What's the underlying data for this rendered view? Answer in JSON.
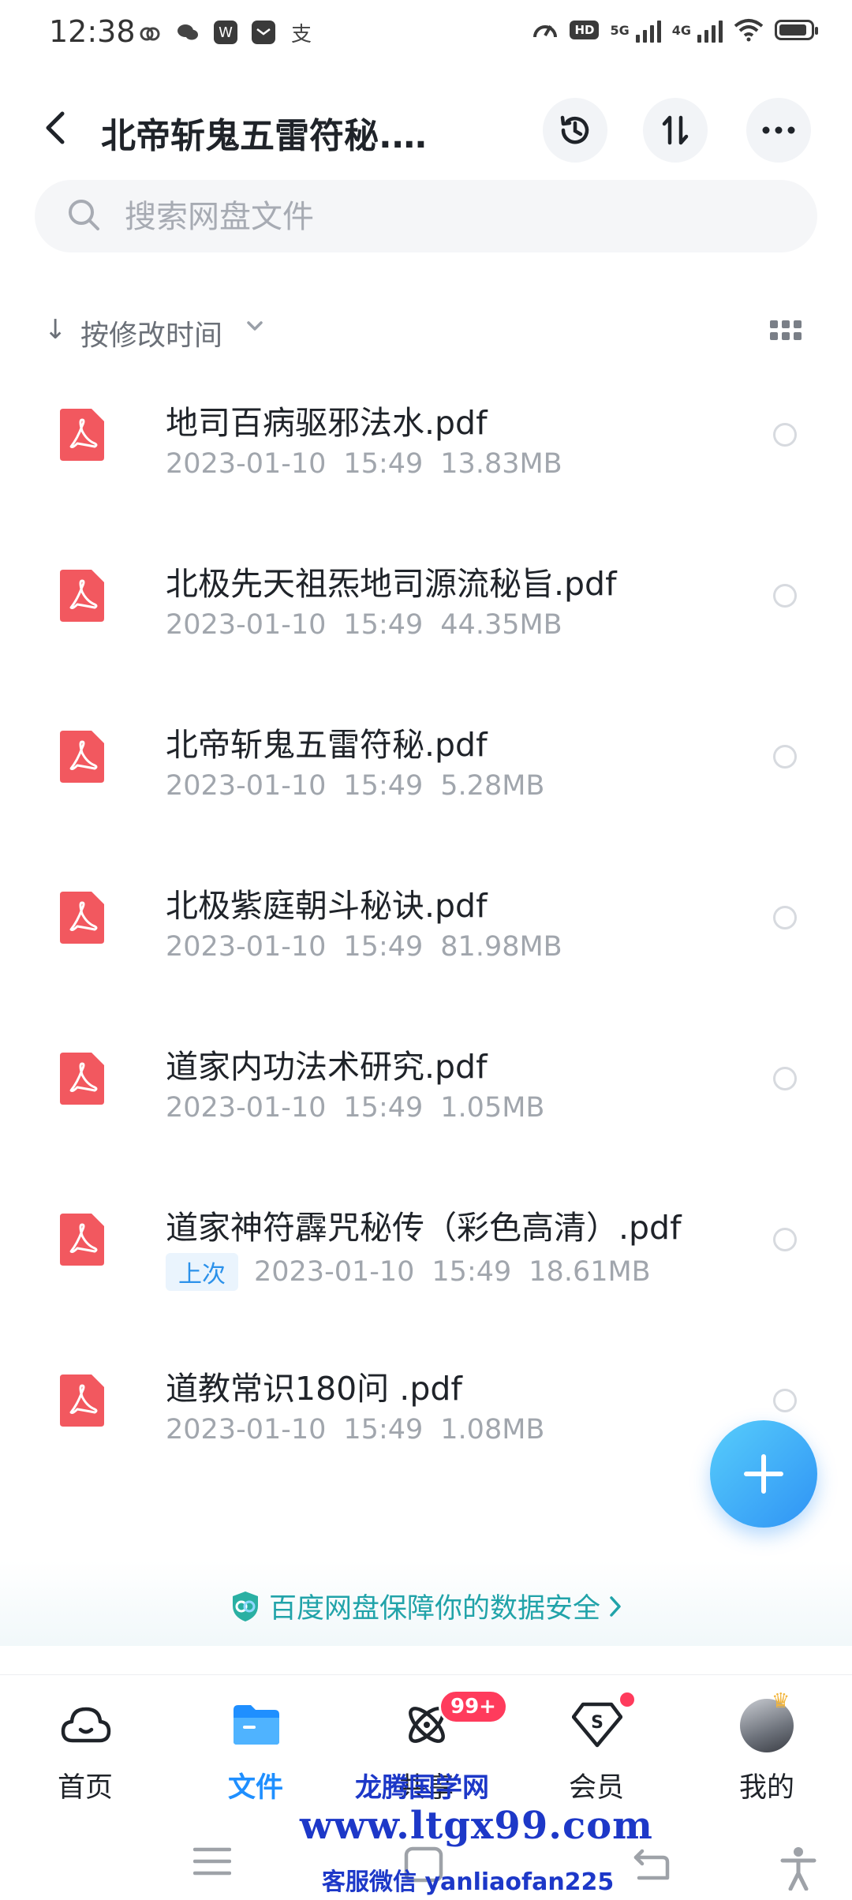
{
  "status_bar": {
    "time": "12:38",
    "app_icons": [
      "baidu-app-icon",
      "wechat-icon",
      "w-app-icon",
      "message-app-icon",
      "alipay-icon"
    ],
    "network_1": "5G",
    "network_2": "4G",
    "hd_label": "HD"
  },
  "header": {
    "title": "北帝斩鬼五雷符秘.…",
    "actions": [
      "history-icon",
      "sort-icon",
      "more-icon"
    ]
  },
  "search": {
    "placeholder": "搜索网盘文件"
  },
  "sort": {
    "label": "按修改时间"
  },
  "files": [
    {
      "name": "地司百病驱邪法水.pdf",
      "date": "2023-01-10",
      "time": "15:49",
      "size": "13.83MB",
      "tag": ""
    },
    {
      "name": "北极先天祖炁地司源流秘旨.pdf",
      "date": "2023-01-10",
      "time": "15:49",
      "size": "44.35MB",
      "tag": ""
    },
    {
      "name": "北帝斩鬼五雷符秘.pdf",
      "date": "2023-01-10",
      "time": "15:49",
      "size": "5.28MB",
      "tag": ""
    },
    {
      "name": "北极紫庭朝斗秘诀.pdf",
      "date": "2023-01-10",
      "time": "15:49",
      "size": "81.98MB",
      "tag": ""
    },
    {
      "name": "道家内功法术研究.pdf",
      "date": "2023-01-10",
      "time": "15:49",
      "size": "1.05MB",
      "tag": ""
    },
    {
      "name": "道家神符霹咒秘传（彩色高清）.pdf",
      "date": "2023-01-10",
      "time": "15:49",
      "size": "18.61MB",
      "tag": "上次"
    },
    {
      "name": "道教常识180问 .pdf",
      "date": "2023-01-10",
      "time": "15:49",
      "size": "1.08MB",
      "tag": ""
    }
  ],
  "banner": {
    "text": "百度网盘保障你的数据安全"
  },
  "bottom_nav": {
    "items": [
      {
        "label": "首页",
        "icon": "cloud-icon",
        "active": false
      },
      {
        "label": "文件",
        "icon": "folder-icon",
        "active": true
      },
      {
        "label": "共享",
        "icon": "atom-icon",
        "active": false,
        "badge": "99+"
      },
      {
        "label": "会员",
        "icon": "diamond-icon",
        "active": false
      },
      {
        "label": "我的",
        "icon": "avatar",
        "active": false
      }
    ]
  },
  "watermark": {
    "title": "龙腾国学网",
    "url": "www.ltgx99.com",
    "contact": "客服微信 yanliaofan225"
  },
  "colors": {
    "accent": "#1f8fff",
    "pdf_red": "#f2585f",
    "security_teal": "#21a3a9",
    "badge_red": "#ff3b5c",
    "watermark_blue": "#1d38c8"
  }
}
